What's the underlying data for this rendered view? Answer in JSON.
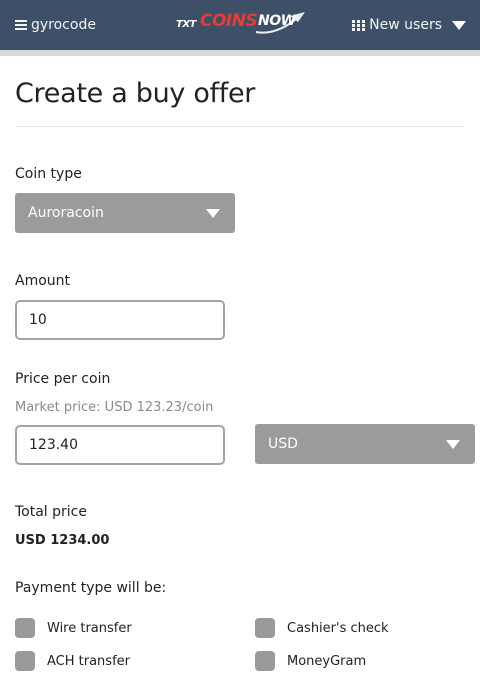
{
  "header": {
    "menu_label": "gyrocode",
    "logo": {
      "txt": "TXT",
      "coins": "COINS",
      "now": "NOW"
    },
    "nav_label": "New users",
    "icons": {
      "menu": "hamburger-icon",
      "nav": "grid-icon",
      "dropdown": "caret-down-icon"
    },
    "colors": {
      "bar": "#3e5068",
      "brand_red": "#e83a36"
    }
  },
  "page": {
    "title": "Create a buy offer"
  },
  "form": {
    "coin_type": {
      "label": "Coin type",
      "value": "Auroracoin"
    },
    "amount": {
      "label": "Amount",
      "value": "10"
    },
    "price_per_coin": {
      "label": "Price per coin",
      "hint": "Market price: USD 123.23/coin",
      "value": "123.40",
      "currency": "USD"
    },
    "total_price": {
      "label": "Total price",
      "value": "USD 1234.00"
    },
    "payment": {
      "label": "Payment type will be:",
      "options": [
        {
          "label": "Wire transfer",
          "checked": false
        },
        {
          "label": "Cashier's check",
          "checked": false
        },
        {
          "label": "ACH transfer",
          "checked": false
        },
        {
          "label": "MoneyGram",
          "checked": false
        }
      ]
    }
  }
}
